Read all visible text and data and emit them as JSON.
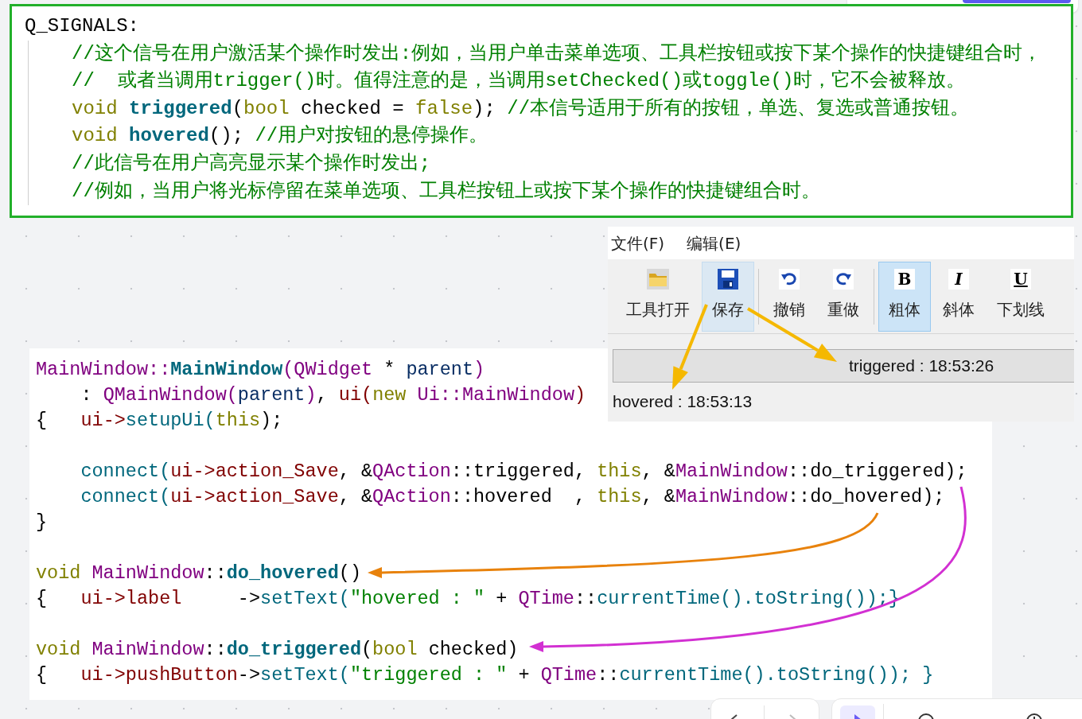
{
  "signals_card": {
    "heading": "Q_SIGNALS:",
    "lines": [
      {
        "tokens": [
          {
            "kind": "comment",
            "text": "//这个信号在用户激活某个操作时发出:例如，当用户单击菜单选项、工具栏按钮或按下某个操作的快捷键组合时，"
          }
        ]
      },
      {
        "tokens": [
          {
            "kind": "comment",
            "text": "//  或者当调用trigger()时。值得注意的是，当调用setChecked()或toggle()时，它不会被释放。"
          }
        ]
      },
      {
        "tokens": [
          {
            "kind": "keyword",
            "text": "void "
          },
          {
            "kind": "func_bold",
            "text": "triggered"
          },
          {
            "kind": "plain",
            "text": "("
          },
          {
            "kind": "keyword",
            "text": "bool"
          },
          {
            "kind": "plain",
            "text": " checked = "
          },
          {
            "kind": "keyword",
            "text": "false"
          },
          {
            "kind": "plain",
            "text": "); "
          },
          {
            "kind": "comment",
            "text": "//本信号适用于所有的按钮，单选、复选或普通按钮。"
          }
        ]
      },
      {
        "tokens": [
          {
            "kind": "keyword",
            "text": "void "
          },
          {
            "kind": "func_bold",
            "text": "hovered"
          },
          {
            "kind": "plain",
            "text": "(); "
          },
          {
            "kind": "comment",
            "text": "//用户对按钮的悬停操作。"
          }
        ]
      },
      {
        "tokens": [
          {
            "kind": "comment",
            "text": "//此信号在用户高亮显示某个操作时发出;"
          }
        ]
      },
      {
        "tokens": [
          {
            "kind": "comment",
            "text": "//例如，当用户将光标停留在菜单选项、工具栏按钮上或按下某个操作的快捷键组合时。"
          }
        ]
      }
    ]
  },
  "qt_window": {
    "menu": [
      "文件(F)",
      "编辑(E)"
    ],
    "toolbar_groups": [
      {
        "buttons": [
          {
            "kind": "folder",
            "label": "工具打开",
            "hovered": false,
            "checked": false
          },
          {
            "kind": "save",
            "label": "保存",
            "hovered": true,
            "checked": false
          }
        ]
      },
      {
        "buttons": [
          {
            "kind": "undo",
            "label": "撤销",
            "hovered": false,
            "checked": false
          },
          {
            "kind": "redo",
            "label": "重做",
            "hovered": false,
            "checked": false
          }
        ]
      },
      {
        "buttons": [
          {
            "kind": "format",
            "glyph": "B",
            "label": "粗体",
            "hovered": false,
            "checked": true
          },
          {
            "kind": "format",
            "glyph": "I",
            "label": "斜体",
            "hovered": false,
            "checked": false
          },
          {
            "kind": "format",
            "glyph": "U",
            "label": "下划线",
            "hovered": false,
            "checked": false
          }
        ]
      }
    ],
    "push_button": "triggered : 18:53:26",
    "label": "hovered : 18:53:13"
  },
  "code_card": {
    "blocks": [
      {
        "lines": [
          {
            "tokens": [
              {
                "kind": "type",
                "text": "MainWindow::"
              },
              {
                "kind": "func_bold",
                "text": "MainWindow"
              },
              {
                "kind": "type",
                "text": "(QWidget"
              },
              {
                "kind": "plain",
                "text": " * "
              },
              {
                "kind": "param",
                "text": "parent"
              },
              {
                "kind": "type",
                "text": ")"
              }
            ]
          },
          {
            "tokens": [
              {
                "kind": "plain",
                "text": "    : "
              },
              {
                "kind": "type",
                "text": "QMainWindow("
              },
              {
                "kind": "param",
                "text": "parent"
              },
              {
                "kind": "type",
                "text": ")"
              },
              {
                "kind": "plain",
                "text": ", "
              },
              {
                "kind": "member",
                "text": "ui("
              },
              {
                "kind": "keyword",
                "text": "new "
              },
              {
                "kind": "type",
                "text": "Ui::MainWindow"
              },
              {
                "kind": "member",
                "text": ")"
              }
            ]
          },
          {
            "tokens": [
              {
                "kind": "plain",
                "text": "{   "
              },
              {
                "kind": "member",
                "text": "ui->"
              },
              {
                "kind": "func",
                "text": "setupUi("
              },
              {
                "kind": "keyword",
                "text": "this"
              },
              {
                "kind": "plain",
                "text": ");"
              }
            ]
          }
        ]
      },
      {
        "lines": [
          {
            "tokens": [
              {
                "kind": "func",
                "text": "    connect("
              },
              {
                "kind": "member",
                "text": "ui->action_Save"
              },
              {
                "kind": "plain",
                "text": ", &"
              },
              {
                "kind": "type",
                "text": "QAction"
              },
              {
                "kind": "plain",
                "text": "::triggered, "
              },
              {
                "kind": "keyword",
                "text": "this"
              },
              {
                "kind": "plain",
                "text": ", &"
              },
              {
                "kind": "type",
                "text": "MainWindow"
              },
              {
                "kind": "plain",
                "text": "::do_triggered);"
              }
            ]
          },
          {
            "tokens": [
              {
                "kind": "func",
                "text": "    connect("
              },
              {
                "kind": "member",
                "text": "ui->action_Save"
              },
              {
                "kind": "plain",
                "text": ", &"
              },
              {
                "kind": "type",
                "text": "QAction"
              },
              {
                "kind": "plain",
                "text": "::hovered  , "
              },
              {
                "kind": "keyword",
                "text": "this"
              },
              {
                "kind": "plain",
                "text": ", &"
              },
              {
                "kind": "type",
                "text": "MainWindow"
              },
              {
                "kind": "plain",
                "text": "::do_hovered);"
              }
            ]
          },
          {
            "tokens": [
              {
                "kind": "plain",
                "text": "}"
              }
            ]
          }
        ]
      },
      {
        "lines": [
          {
            "tokens": [
              {
                "kind": "keyword",
                "text": "void "
              },
              {
                "kind": "type",
                "text": "MainWindow"
              },
              {
                "kind": "plain",
                "text": "::"
              },
              {
                "kind": "func_bold",
                "text": "do_hovered"
              },
              {
                "kind": "plain",
                "text": "()"
              }
            ]
          },
          {
            "tokens": [
              {
                "kind": "plain",
                "text": "{   "
              },
              {
                "kind": "member",
                "text": "ui->label"
              },
              {
                "kind": "plain",
                "text": "     ->"
              },
              {
                "kind": "func",
                "text": "setText("
              },
              {
                "kind": "string",
                "text": "\"hovered : \""
              },
              {
                "kind": "plain",
                "text": " + "
              },
              {
                "kind": "type",
                "text": "QTime"
              },
              {
                "kind": "plain",
                "text": "::"
              },
              {
                "kind": "func",
                "text": "currentTime().toString());}"
              }
            ]
          }
        ]
      },
      {
        "lines": [
          {
            "tokens": [
              {
                "kind": "keyword",
                "text": "void "
              },
              {
                "kind": "type",
                "text": "MainWindow"
              },
              {
                "kind": "plain",
                "text": "::"
              },
              {
                "kind": "func_bold",
                "text": "do_triggered"
              },
              {
                "kind": "plain",
                "text": "("
              },
              {
                "kind": "keyword",
                "text": "bool"
              },
              {
                "kind": "plain",
                "text": " checked)"
              }
            ]
          },
          {
            "tokens": [
              {
                "kind": "plain",
                "text": "{   "
              },
              {
                "kind": "member",
                "text": "ui->pushButton"
              },
              {
                "kind": "plain",
                "text": "->"
              },
              {
                "kind": "func",
                "text": "setText("
              },
              {
                "kind": "string",
                "text": "\"triggered : \""
              },
              {
                "kind": "plain",
                "text": " + "
              },
              {
                "kind": "type",
                "text": "QTime"
              },
              {
                "kind": "plain",
                "text": "::"
              },
              {
                "kind": "func",
                "text": "currentTime().toString()); }"
              }
            ]
          }
        ]
      }
    ]
  }
}
